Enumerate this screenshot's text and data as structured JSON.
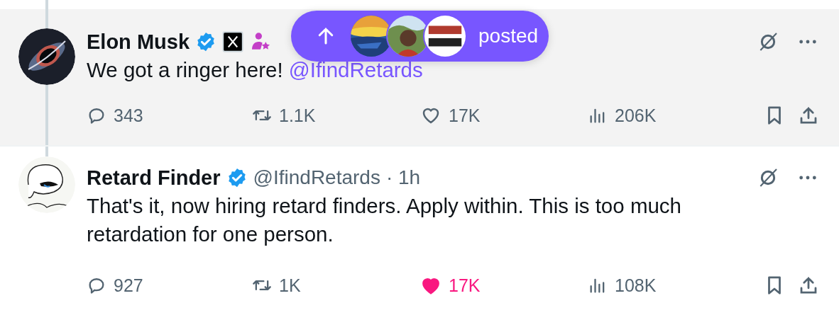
{
  "tweets": [
    {
      "author": "Elon Musk",
      "verified": true,
      "badges": [
        {
          "kind": "affiliate"
        },
        {
          "kind": "subscriber"
        }
      ],
      "text": "We got a ringer here! ",
      "mention": "@IfindRetards",
      "stats": {
        "replies": "343",
        "reposts": "1.1K",
        "likes": "17K",
        "views": "206K"
      },
      "liked": false,
      "highlighted": true
    },
    {
      "author": "Retard Finder",
      "verified": true,
      "handle": "@IfindRetards",
      "time": "· 1h",
      "text": "That's it, now hiring retard finders. Apply within. This is too much retardation for one person.",
      "stats": {
        "replies": "927",
        "reposts": "1K",
        "likes": "17K",
        "views": "108K"
      },
      "liked": true,
      "highlighted": false
    }
  ],
  "new_posts_pill": {
    "label": "posted"
  }
}
